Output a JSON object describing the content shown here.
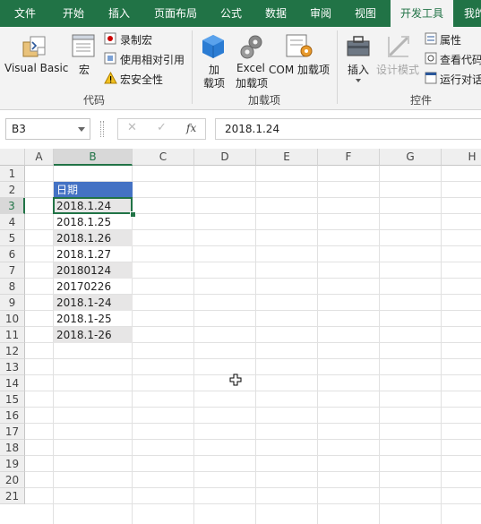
{
  "tabs": [
    {
      "label": "文件",
      "active": false
    },
    {
      "label": "开始",
      "active": false
    },
    {
      "label": "插入",
      "active": false
    },
    {
      "label": "页面布局",
      "active": false
    },
    {
      "label": "公式",
      "active": false
    },
    {
      "label": "数据",
      "active": false
    },
    {
      "label": "审阅",
      "active": false
    },
    {
      "label": "视图",
      "active": false
    },
    {
      "label": "开发工具",
      "active": true
    },
    {
      "label": "我的",
      "active": false
    }
  ],
  "ribbon": {
    "code_group": {
      "label": "代码",
      "visual_basic": "Visual Basic",
      "macro": "宏",
      "record_macro": "录制宏",
      "relative_ref": "使用相对引用",
      "macro_security": "宏安全性"
    },
    "addins_group": {
      "label": "加载项",
      "addins_line1": "加",
      "addins_line2": "载项",
      "excel_line1": "Excel",
      "excel_line2": "加载项",
      "com": "COM 加载项"
    },
    "controls_group": {
      "label": "控件",
      "insert": "插入",
      "design_mode": "设计模式",
      "properties": "属性",
      "view_code": "查看代码",
      "run_dialog": "运行对话"
    }
  },
  "formula_bar": {
    "name_box": "B3",
    "cancel_glyph": "✕",
    "confirm_glyph": "✓",
    "fx_glyph": "fx",
    "formula": "2018.1.24"
  },
  "columns": [
    "A",
    "B",
    "C",
    "D",
    "E",
    "F",
    "G",
    "H"
  ],
  "selected_column": "B",
  "selected_row": 3,
  "rows": [
    "1",
    "2",
    "3",
    "4",
    "5",
    "6",
    "7",
    "8",
    "9",
    "10",
    "11",
    "12",
    "13",
    "14",
    "15",
    "16",
    "17",
    "18",
    "19",
    "20",
    "21"
  ],
  "column_b": {
    "header": "日期",
    "values": [
      "2018.1.24",
      "2018.1.25",
      "2018.1.26",
      "2018.1.27",
      "20180124",
      "20170226",
      "2018.1-24",
      "2018.1-25",
      "2018.1-26"
    ]
  },
  "colors": {
    "ribbon_green": "#217346",
    "header_fill": "#4472c4",
    "band_fill": "#e7e6e6"
  }
}
